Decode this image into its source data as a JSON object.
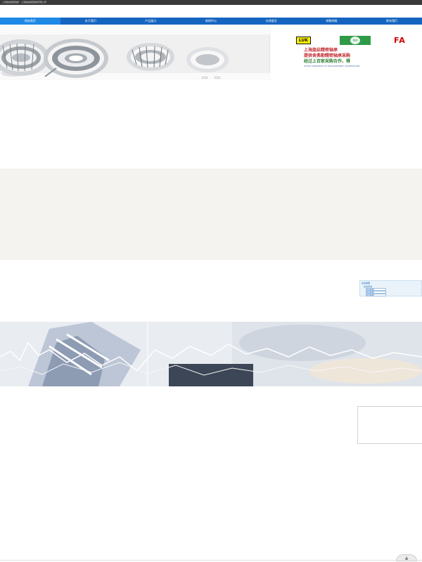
{
  "window": {
    "title": "上海旋启精密轴承 - 上海旋启精密轴承有限公司"
  },
  "nav": {
    "items": [
      {
        "label": "网站首页",
        "active": true
      },
      {
        "label": "关于我们",
        "active": false
      },
      {
        "label": "产品展示",
        "active": false
      },
      {
        "label": "新闻中心",
        "active": false
      },
      {
        "label": "在线留言",
        "active": false
      },
      {
        "label": "销售网络",
        "active": false
      },
      {
        "label": "联系我们",
        "active": false
      }
    ]
  },
  "banner": {
    "brands": [
      "LUK",
      "INA",
      "FA"
    ],
    "lines": [
      "上海旋启精密轴承",
      "提供舍弗勒精密轴承采购",
      "经过上百家采购合作，得",
      "AFTER HUNDREDS OF PROCUREMENT COOPERATION"
    ],
    "slide_count": 2,
    "active_slide": 1
  },
  "sidebox": {
    "title": "在线客服",
    "subtitle": "在线咨询",
    "chips": [
      "QQ客服",
      "QQ客服",
      "QQ客服"
    ]
  },
  "scroll_top": {
    "label": "▲"
  },
  "colors": {
    "nav": "#1565c0",
    "nav_active": "#1e88e5",
    "accent_red": "#c1272d",
    "accent_green": "#2e7d32",
    "section_beige": "#f4f3ef"
  }
}
